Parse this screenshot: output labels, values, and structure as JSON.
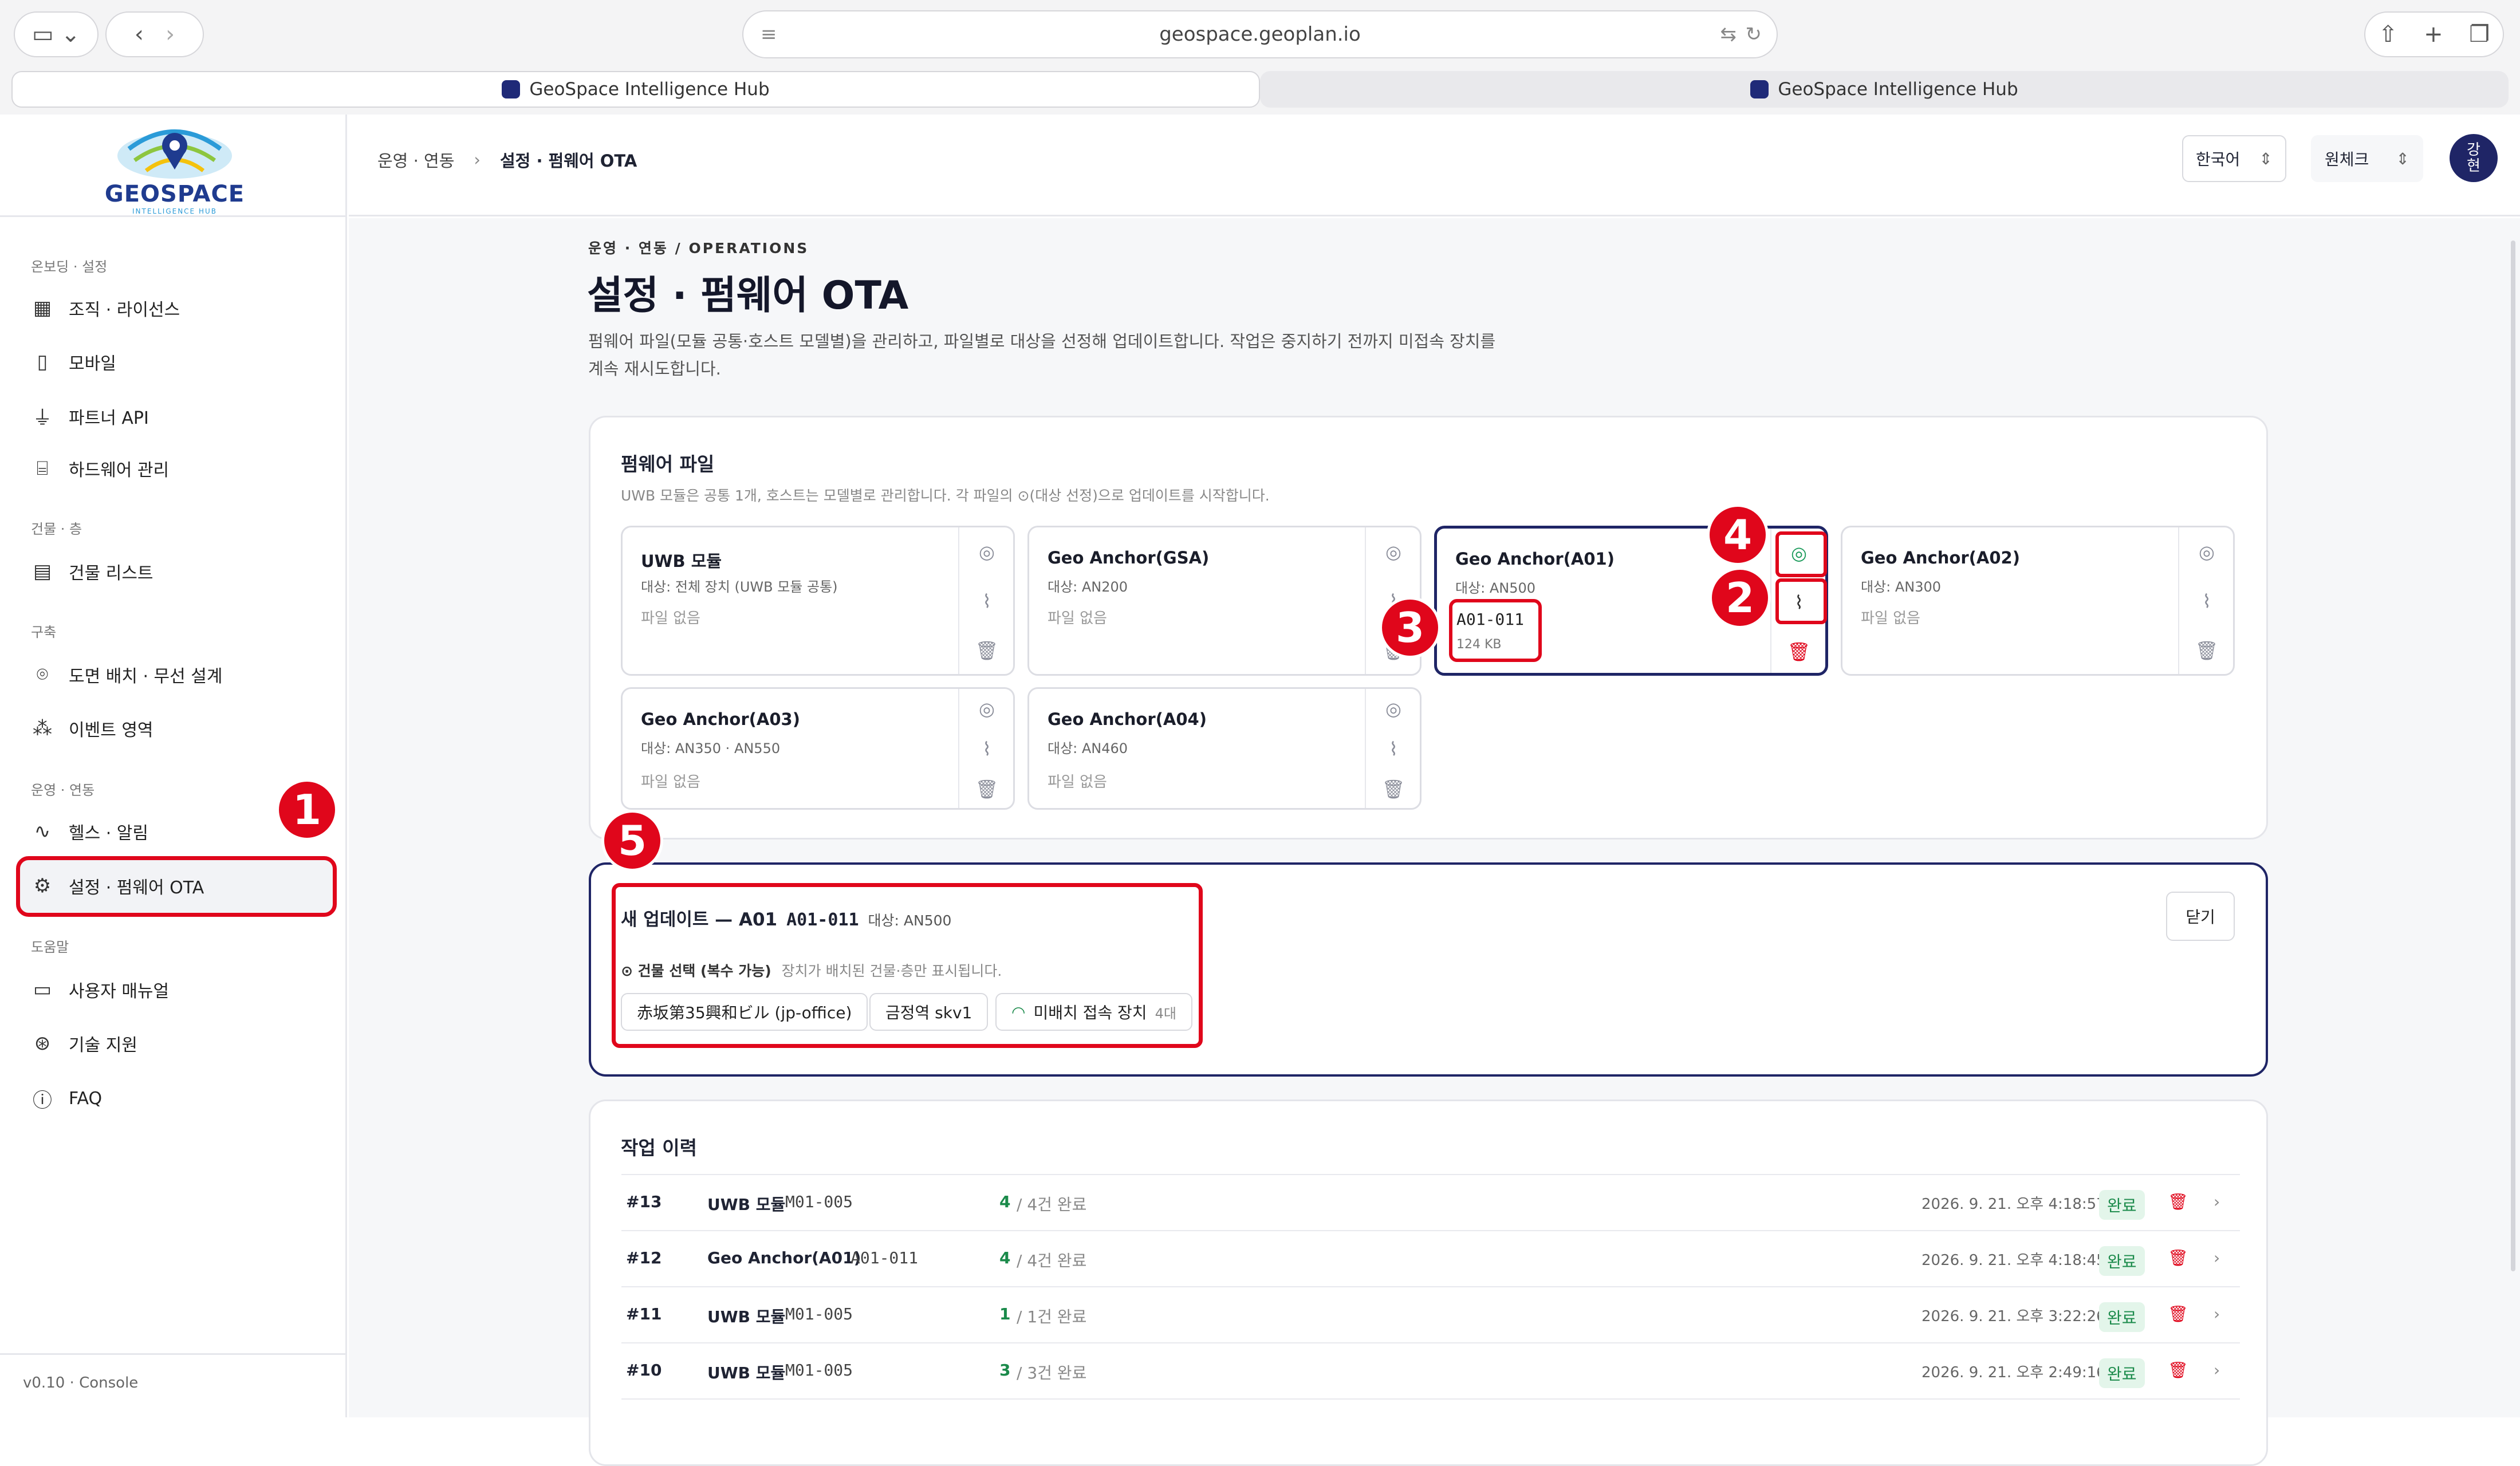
{
  "browser": {
    "url": "geospace.geoplan.io",
    "tabs": [
      {
        "label": "GeoSpace Intelligence Hub"
      },
      {
        "label": "GeoSpace Intelligence Hub"
      }
    ]
  },
  "logo": {
    "name": "GEOSPACE",
    "tagline": "INTELLIGENCE HUB"
  },
  "sidebar": {
    "sections": [
      {
        "title": "온보딩 · 설정",
        "items": [
          {
            "label": "조직 · 라이선스",
            "icon": "building-icon"
          },
          {
            "label": "모바일",
            "icon": "mobile-icon"
          },
          {
            "label": "파트너 API",
            "icon": "plug-icon"
          },
          {
            "label": "하드웨어 관리",
            "icon": "hardware-icon"
          }
        ]
      },
      {
        "title": "건물 · 층",
        "items": [
          {
            "label": "건물 리스트",
            "icon": "building-list-icon"
          }
        ]
      },
      {
        "title": "구축",
        "items": [
          {
            "label": "도면 배치 · 무선 설계",
            "icon": "location-pin-icon"
          },
          {
            "label": "이벤트 영역",
            "icon": "event-area-icon"
          }
        ]
      },
      {
        "title": "운영 · 연동",
        "items": [
          {
            "label": "헬스 · 알림",
            "icon": "pulse-icon"
          },
          {
            "label": "설정 · 펌웨어 OTA",
            "icon": "gear-icon"
          }
        ]
      },
      {
        "title": "도움말",
        "items": [
          {
            "label": "사용자 매뉴얼",
            "icon": "book-icon"
          },
          {
            "label": "기술 지원",
            "icon": "lifebuoy-icon"
          },
          {
            "label": "FAQ",
            "icon": "question-icon"
          }
        ]
      }
    ],
    "version": "v0.10 · Console"
  },
  "topbar": {
    "breadcrumb": [
      "운영 · 연동",
      "설정 · 펌웨어 OTA"
    ],
    "language": "한국어",
    "org": "원체크",
    "avatar": "강\n현"
  },
  "page": {
    "eyebrow": "운영 · 연동 / OPERATIONS",
    "title": "설정 · 펌웨어 OTA",
    "desc1": "펌웨어 파일(모듈 공통·호스트 모델별)을 관리하고, 파일별로 대상을 선정해 업데이트합니다. 작업은 중지하기 전까지 미접속 장치를",
    "desc2": "계속 재시도합니다."
  },
  "firmware": {
    "title": "펌웨어 파일",
    "subtitle": "UWB 모듈은 공통 1개, 호스트는 모델별로 관리합니다. 각 파일의 ⊙(대상 선정)으로 업데이트를 시작합니다.",
    "files": [
      {
        "name": "UWB 모듈",
        "target": "대상: 전체 장치 (UWB 모듈 공통)",
        "status": "파일 없음"
      },
      {
        "name": "Geo Anchor(GSA)",
        "target": "대상: AN200",
        "status": "파일 없음"
      },
      {
        "name": "Geo Anchor(A01)",
        "target": "대상: AN500",
        "file": "A01-011",
        "size": "124 KB"
      },
      {
        "name": "Geo Anchor(A02)",
        "target": "대상: AN300",
        "status": "파일 없음"
      },
      {
        "name": "Geo Anchor(A03)",
        "target": "대상: AN350 · AN550",
        "status": "파일 없음"
      },
      {
        "name": "Geo Anchor(A04)",
        "target": "대상: AN460",
        "status": "파일 없음"
      }
    ]
  },
  "newupdate": {
    "title": "새 업데이트 — A01",
    "file": "A01-011",
    "target": "대상: AN500",
    "close": "닫기",
    "building_label": "⊙ 건물 선택 (복수 가능)",
    "building_hint": "장치가 배치된 건물·층만 표시됩니다.",
    "chips": [
      {
        "label": "赤坂第35興和ビル (jp-office)"
      },
      {
        "label": "금정역 skv1"
      },
      {
        "label": "미배치 접속 장치",
        "count": "4대"
      }
    ]
  },
  "history": {
    "title": "작업 이력",
    "rows": [
      {
        "id": "#13",
        "name": "UWB 모듈",
        "file": "M01-005",
        "done": "4",
        "total": "/ 4건 완료",
        "time": "2026. 9. 21. 오후 4:18:57",
        "status": "완료"
      },
      {
        "id": "#12",
        "name": "Geo Anchor(A01)",
        "file": "A01-011",
        "done": "4",
        "total": "/ 4건 완료",
        "time": "2026. 9. 21. 오후 4:18:45",
        "status": "완료"
      },
      {
        "id": "#11",
        "name": "UWB 모듈",
        "file": "M01-005",
        "done": "1",
        "total": "/ 1건 완료",
        "time": "2026. 9. 21. 오후 3:22:26",
        "status": "완료"
      },
      {
        "id": "#10",
        "name": "UWB 모듈",
        "file": "M01-005",
        "done": "3",
        "total": "/ 3건 완료",
        "time": "2026. 9. 21. 오후 2:49:16",
        "status": "완료"
      }
    ]
  },
  "markers": [
    "1",
    "2",
    "3",
    "4",
    "5"
  ],
  "colors": {
    "accent": "#1f2566",
    "highlight": "#e0061b",
    "success": "#1a8a4a"
  }
}
